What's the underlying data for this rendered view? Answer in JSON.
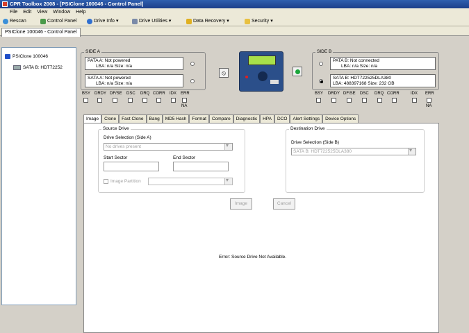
{
  "window": {
    "title": "CPR Toolbox 2008 - [PSIClone 100046 - Control Panel]"
  },
  "menu": [
    "File",
    "Edit",
    "View",
    "Window",
    "Help"
  ],
  "toolbar": {
    "rescan": "Rescan",
    "control_panel": "Control Panel",
    "drive_info": "Drive Info",
    "drive_utilities": "Drive Utilities",
    "data_recovery": "Data Recovery",
    "security": "Security"
  },
  "doc_tab": "PSIClone 100046 - Control Panel",
  "tree": {
    "root": "PSIClone 100046",
    "child": "SATA B: HDT72252"
  },
  "side_a": {
    "label": "SIDE A",
    "box1": {
      "line1": "PATA A: Not powered",
      "line2": "LBA: n/a  Size: n/a"
    },
    "box2": {
      "line1": "SATA A: Not powered",
      "line2": "LBA: n/a  Size: n/a"
    }
  },
  "side_b": {
    "label": "SIDE B",
    "box1": {
      "line1": "PATA B: Not connected",
      "line2": "LBA: n/a  Size: n/a"
    },
    "box2": {
      "line1": "SATA B: HDT722525DLA380",
      "line2": "LBA: 488397168  Size: 232 GB"
    }
  },
  "status_labels": [
    "BSY",
    "DRDY",
    "DF/SE",
    "DSC",
    "DRQ",
    "CORR",
    "IDX",
    "ERR"
  ],
  "err_value": "NA",
  "tabs": [
    "Image",
    "Clone",
    "Fast Clone",
    "Bang",
    "MD5 Hash",
    "Format",
    "Compare",
    "Diagnostic",
    "HPA",
    "DCO",
    "Alert Settings",
    "Device Options"
  ],
  "image_tab": {
    "source_drive": "Source Drive",
    "drive_selection_a": "Drive Selection (Side A)",
    "source_value": "No drives present",
    "start_sector": "Start Sector",
    "end_sector": "End Sector",
    "image_partition": "Image Partition",
    "destination_drive": "Destination Drive",
    "drive_selection_b": "Drive Selection (Side B)",
    "dest_value": "SATA B: HDT722525DLA380",
    "image_button": "Image",
    "cancel_button": "Cancel",
    "error": "Error: Source Drive Not Available."
  },
  "colors": {
    "titlebar": "#1c3f8a",
    "device_panel": "#2b4f8a",
    "led_green": "#1aa53a"
  }
}
